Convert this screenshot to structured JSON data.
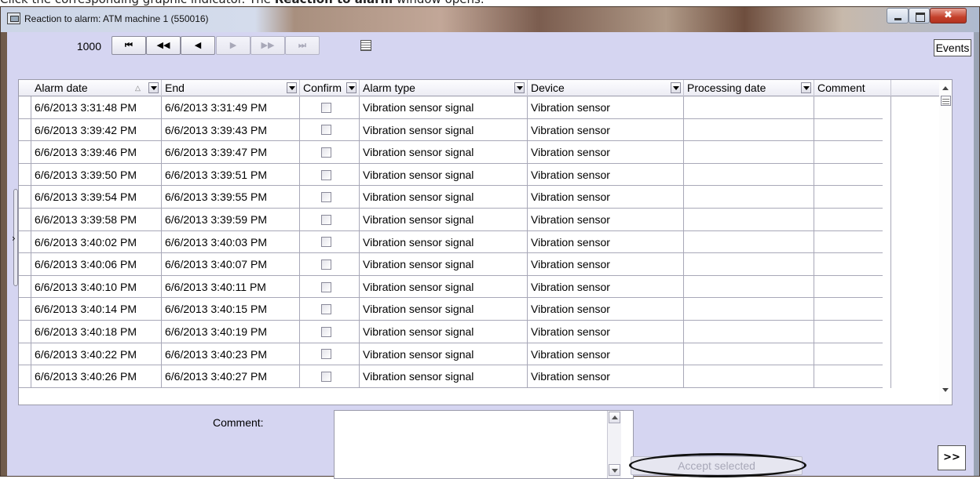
{
  "caption": {
    "prefix": "Click the corresponding graphic indicator. The ",
    "bold": "Reaction to alarm",
    "suffix": " window opens."
  },
  "window": {
    "title": "Reaction to alarm: ATM machine 1 (550016)",
    "icon": "window-app-icon"
  },
  "toolbar": {
    "page_size": "1000",
    "buttons": [
      {
        "name": "first-page",
        "glyph": "⏮",
        "enabled": true
      },
      {
        "name": "prev-page",
        "glyph": "◀◀",
        "enabled": true
      },
      {
        "name": "prev-record",
        "glyph": "◀",
        "enabled": true
      },
      {
        "name": "next-record",
        "glyph": "▶",
        "enabled": false
      },
      {
        "name": "next-page",
        "glyph": "▶▶",
        "enabled": false
      },
      {
        "name": "last-page",
        "glyph": "⏭",
        "enabled": false
      }
    ],
    "events_label": "Events"
  },
  "grid": {
    "columns": [
      {
        "key": "alarm_date",
        "label": "Alarm date"
      },
      {
        "key": "end",
        "label": "End"
      },
      {
        "key": "confirm",
        "label": "Confirm"
      },
      {
        "key": "alarm_type",
        "label": "Alarm type"
      },
      {
        "key": "device",
        "label": "Device"
      },
      {
        "key": "processing_date",
        "label": "Processing date"
      },
      {
        "key": "comment",
        "label": "Comment"
      }
    ],
    "rows": [
      {
        "alarm_date": "6/6/2013 3:31:48 PM",
        "end": "6/6/2013 3:31:49 PM",
        "confirm": false,
        "alarm_type": "Vibration sensor signal",
        "device": "Vibration sensor",
        "processing_date": "",
        "comment": ""
      },
      {
        "alarm_date": "6/6/2013 3:39:42 PM",
        "end": "6/6/2013 3:39:43 PM",
        "confirm": false,
        "alarm_type": "Vibration sensor signal",
        "device": "Vibration sensor",
        "processing_date": "",
        "comment": ""
      },
      {
        "alarm_date": "6/6/2013 3:39:46 PM",
        "end": "6/6/2013 3:39:47 PM",
        "confirm": false,
        "alarm_type": "Vibration sensor signal",
        "device": "Vibration sensor",
        "processing_date": "",
        "comment": ""
      },
      {
        "alarm_date": "6/6/2013 3:39:50 PM",
        "end": "6/6/2013 3:39:51 PM",
        "confirm": false,
        "alarm_type": "Vibration sensor signal",
        "device": "Vibration sensor",
        "processing_date": "",
        "comment": ""
      },
      {
        "alarm_date": "6/6/2013 3:39:54 PM",
        "end": "6/6/2013 3:39:55 PM",
        "confirm": false,
        "alarm_type": "Vibration sensor signal",
        "device": "Vibration sensor",
        "processing_date": "",
        "comment": ""
      },
      {
        "alarm_date": "6/6/2013 3:39:58 PM",
        "end": "6/6/2013 3:39:59 PM",
        "confirm": false,
        "alarm_type": "Vibration sensor signal",
        "device": "Vibration sensor",
        "processing_date": "",
        "comment": ""
      },
      {
        "alarm_date": "6/6/2013 3:40:02 PM",
        "end": "6/6/2013 3:40:03 PM",
        "confirm": false,
        "alarm_type": "Vibration sensor signal",
        "device": "Vibration sensor",
        "processing_date": "",
        "comment": ""
      },
      {
        "alarm_date": "6/6/2013 3:40:06 PM",
        "end": "6/6/2013 3:40:07 PM",
        "confirm": false,
        "alarm_type": "Vibration sensor signal",
        "device": "Vibration sensor",
        "processing_date": "",
        "comment": ""
      },
      {
        "alarm_date": "6/6/2013 3:40:10 PM",
        "end": "6/6/2013 3:40:11 PM",
        "confirm": false,
        "alarm_type": "Vibration sensor signal",
        "device": "Vibration sensor",
        "processing_date": "",
        "comment": ""
      },
      {
        "alarm_date": "6/6/2013 3:40:14 PM",
        "end": "6/6/2013 3:40:15 PM",
        "confirm": false,
        "alarm_type": "Vibration sensor signal",
        "device": "Vibration sensor",
        "processing_date": "",
        "comment": ""
      },
      {
        "alarm_date": "6/6/2013 3:40:18 PM",
        "end": "6/6/2013 3:40:19 PM",
        "confirm": false,
        "alarm_type": "Vibration sensor signal",
        "device": "Vibration sensor",
        "processing_date": "",
        "comment": ""
      },
      {
        "alarm_date": "6/6/2013 3:40:22 PM",
        "end": "6/6/2013 3:40:23 PM",
        "confirm": false,
        "alarm_type": "Vibration sensor signal",
        "device": "Vibration sensor",
        "processing_date": "",
        "comment": ""
      },
      {
        "alarm_date": "6/6/2013 3:40:26 PM",
        "end": "6/6/2013 3:40:27 PM",
        "confirm": false,
        "alarm_type": "Vibration sensor signal",
        "device": "Vibration sensor",
        "processing_date": "",
        "comment": ""
      }
    ]
  },
  "footer": {
    "comment_label": "Comment:",
    "comment_value": "",
    "accept_label": "Accept selected",
    "more_label": ">>"
  }
}
